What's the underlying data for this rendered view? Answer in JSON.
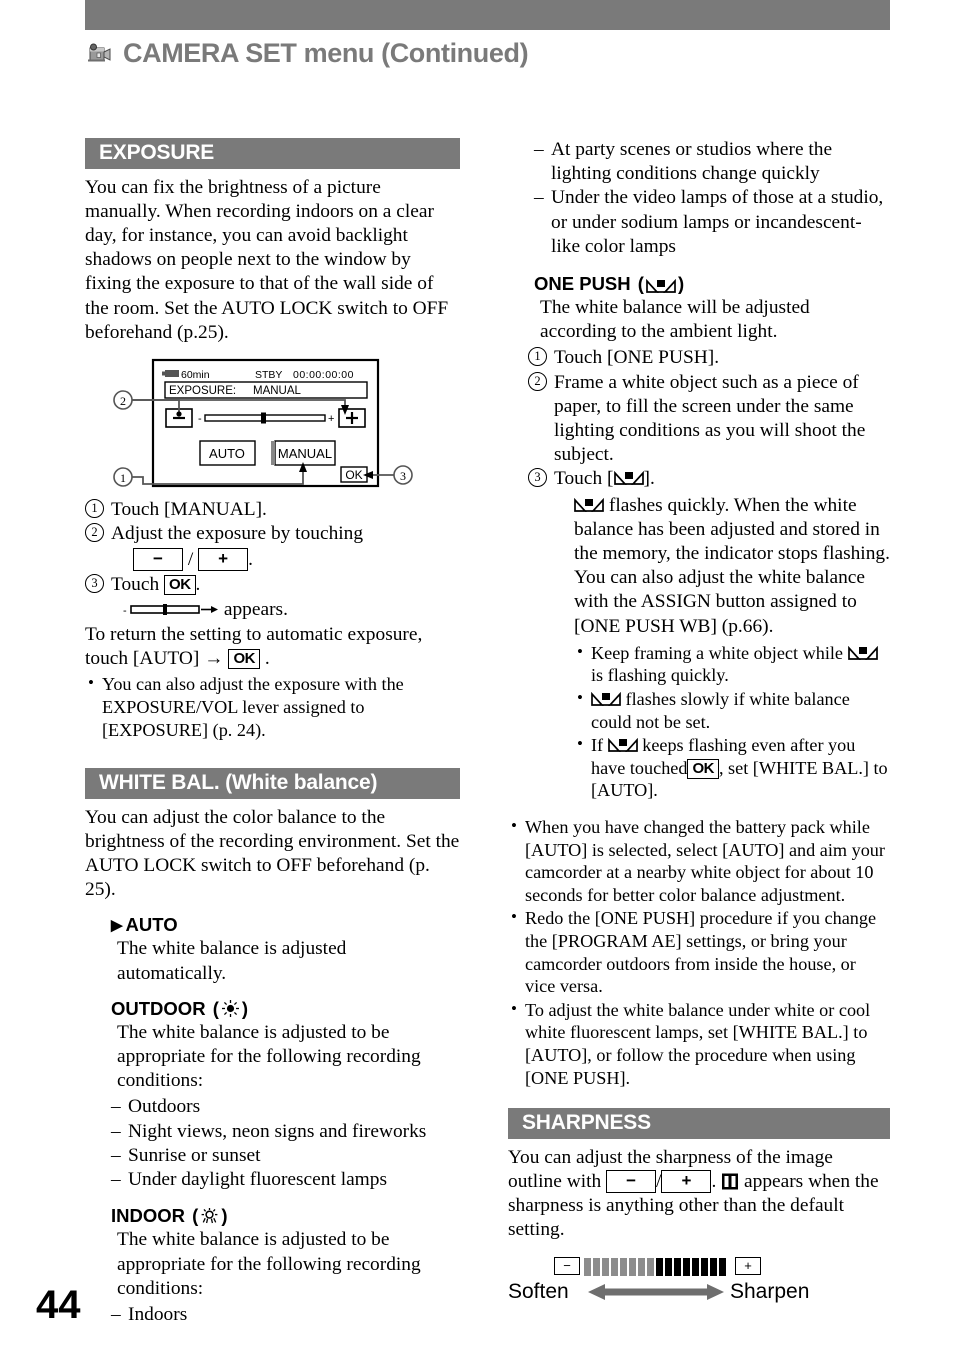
{
  "header": {
    "title": "CAMERA SET menu (Continued)",
    "icon": "camcorder-icon"
  },
  "page_number": "44",
  "left_column": {
    "exposure": {
      "section_title": "EXPOSURE",
      "intro": "You can fix the brightness of a picture manually. When recording indoors on a clear day, for instance, you can avoid backlight shadows on people next to the window by fixing the exposure to that of the wall side of the room. Set the AUTO LOCK switch to OFF beforehand (p.25).",
      "lcd_figure": {
        "battery_label": "60min",
        "status": "STBY",
        "timecode": "00:00:00:00",
        "menu_label": "EXPOSURE:",
        "menu_value": "MANUAL",
        "minus_key": "−",
        "plus_key": "+",
        "scale_minus": "-",
        "scale_plus": "+",
        "auto_button": "AUTO",
        "manual_button": "MANUAL",
        "ok_button": "OK",
        "callout_1": "1",
        "callout_2": "2",
        "callout_3": "3"
      },
      "steps": [
        {
          "num": "1",
          "text_before": "Touch [MANUAL].",
          "text_after": ""
        },
        {
          "num": "2",
          "text_before": "Adjust the exposure by touching",
          "text_after": ""
        },
        {
          "num": "3",
          "text_before": "Touch",
          "text_after": "."
        }
      ],
      "step2_keys": {
        "minus": "−",
        "slash": "/",
        "plus": "+",
        "period": "."
      },
      "step3_key": "OK",
      "appears_text": "appears.",
      "return_text_1": "To return the setting to automatic exposure, touch [AUTO]",
      "return_arrow": "→",
      "return_key": "OK",
      "return_text_2": ".",
      "bullets": [
        "You can also adjust the exposure with the EXPOSURE/VOL lever assigned to [EXPOSURE] (p. 24)."
      ]
    },
    "white_bal": {
      "section_title": "WHITE BAL. (White balance)",
      "intro": "You can adjust the color balance to the brightness of the recording environment. Set the AUTO LOCK switch to OFF beforehand (p. 25).",
      "options": [
        {
          "marker": "▶",
          "name": "AUTO",
          "icon": "",
          "body": "The white balance is adjusted automatically.",
          "list": []
        },
        {
          "marker": "",
          "name": "OUTDOOR",
          "icon": "sun-icon",
          "body": "The white balance is adjusted to be appropriate for the following recording conditions:",
          "list": [
            "Outdoors",
            "Night views, neon signs and fireworks",
            "Sunrise or sunset",
            "Under daylight fluorescent lamps"
          ]
        },
        {
          "marker": "",
          "name": "INDOOR",
          "icon": "bulb-icon",
          "body": "The white balance is adjusted to be appropriate for the following recording conditions:",
          "list": [
            "Indoors"
          ]
        }
      ]
    }
  },
  "right_column": {
    "indoor_continued": [
      "At party scenes or studios where the lighting conditions change quickly",
      "Under the video lamps of those at a studio, or under sodium lamps or incandescent-like color lamps"
    ],
    "one_push": {
      "name": "ONE PUSH",
      "icon": "one-push-wb-icon",
      "body": "The white balance will be adjusted according to the ambient light.",
      "steps": [
        {
          "num": "1",
          "text": "Touch [ONE PUSH]."
        },
        {
          "num": "2",
          "text": "Frame a white object such as a piece of paper, to fill the screen under the same lighting conditions as you will shoot the subject."
        },
        {
          "num": "3",
          "text_before": "Touch [",
          "text_after": "]."
        }
      ],
      "detail_1_after_icon": "flashes quickly. When the white balance has been adjusted and stored in the memory, the indicator stops flashing.",
      "detail_2": "You can also adjust the white balance with the ASSIGN button assigned to [ONE PUSH WB] (p.66).",
      "sub_bullets": [
        {
          "pre": "Keep framing a white object while",
          "post": "is flashing quickly.",
          "icon_pos": "mid"
        },
        {
          "pre": "",
          "post": "flashes slowly if white balance could not be set.",
          "icon_pos": "start"
        },
        {
          "pre": "If",
          "mid": "keeps flashing even after you have touched",
          "key": "OK",
          "post": ", set [WHITE BAL.] to [AUTO].",
          "icon_pos": "after-if"
        }
      ]
    },
    "notes": [
      "When you have changed the battery pack while [AUTO] is selected, select [AUTO] and aim your camcorder at a nearby white object for about 10 seconds for better color balance adjustment.",
      "Redo the [ONE PUSH] procedure if you change the [PROGRAM AE] settings, or bring your camcorder outdoors from inside the house, or vice versa.",
      "To adjust the white balance under white or cool white fluorescent lamps, set [WHITE BAL.] to [AUTO], or follow the procedure when using [ONE PUSH]."
    ],
    "sharpness": {
      "section_title": "SHARPNESS",
      "text_1": "You can adjust the sharpness of the image outline with",
      "minus_key": "−",
      "slash": "/",
      "plus_key": "+",
      "text_2": ".",
      "text_3": "appears when the sharpness is anything other than the default setting.",
      "figure": {
        "minus": "−",
        "plus": "+",
        "soften_label": "Soften",
        "sharpen_label": "Sharpen",
        "gray_bars": 8,
        "black_bars": 8
      }
    }
  },
  "colors": {
    "header_gray": "#7a7a7a",
    "bar_gray": "#8c8c8c",
    "black": "#000000"
  }
}
